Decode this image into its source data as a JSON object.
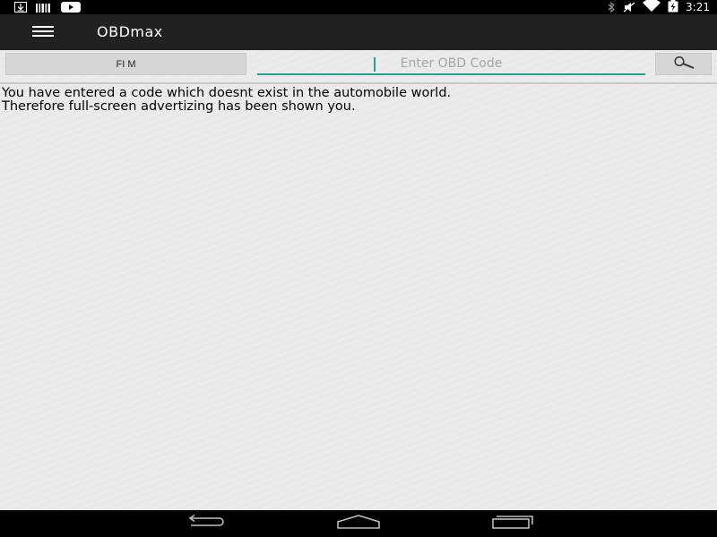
{
  "status_bar": {
    "time": "3:21",
    "left_icons": [
      "download-icon",
      "barcode-icon",
      "youtube-icon"
    ],
    "right_icons": [
      "bluetooth-icon",
      "mute-icon",
      "wifi-icon",
      "battery-icon"
    ]
  },
  "app_bar": {
    "title": "OBDmax"
  },
  "search": {
    "mode_label": "FI M",
    "placeholder": "Enter OBD Code",
    "value": ""
  },
  "message": {
    "line1": "You have entered a code which doesnt exist in the automobile world.",
    "line2": "Therefore full-screen advertizing has been shown you."
  },
  "nav_bar": {
    "buttons": [
      "back-icon",
      "home-icon",
      "recents-icon"
    ]
  },
  "colors": {
    "accent": "#2a9d8f",
    "app_bar": "#212121",
    "background": "#e9e9e9"
  }
}
